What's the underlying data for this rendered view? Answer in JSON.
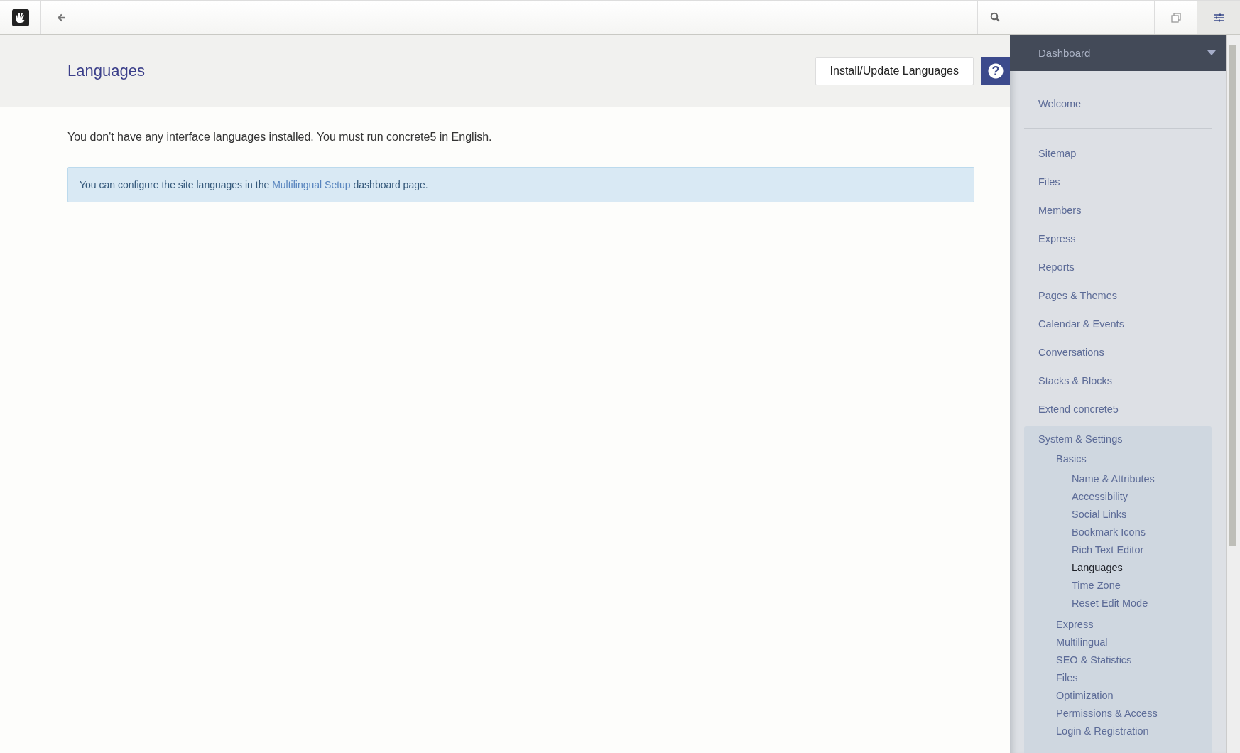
{
  "header": {
    "title": "Languages",
    "install_button": "Install/Update Languages",
    "help_button": "?"
  },
  "message": "You don't have any interface languages installed. You must run concrete5 in English.",
  "alert": {
    "before": "You can configure the site languages in the ",
    "link": "Multilingual Setup",
    "after": " dashboard page."
  },
  "sidebar": {
    "title": "Dashboard",
    "top_items": [
      {
        "label": "Welcome",
        "selected": false
      }
    ],
    "items": [
      {
        "label": "Sitemap",
        "selected": false
      },
      {
        "label": "Files",
        "selected": false
      },
      {
        "label": "Members",
        "selected": false
      },
      {
        "label": "Express",
        "selected": false
      },
      {
        "label": "Reports",
        "selected": false
      },
      {
        "label": "Pages & Themes",
        "selected": false
      },
      {
        "label": "Calendar & Events",
        "selected": false
      },
      {
        "label": "Conversations",
        "selected": false
      },
      {
        "label": "Stacks & Blocks",
        "selected": false
      },
      {
        "label": "Extend concrete5",
        "selected": false
      },
      {
        "label": "System & Settings",
        "selected": false,
        "children": [
          {
            "label": "Basics",
            "selected": false,
            "children": [
              {
                "label": "Name & Attributes",
                "selected": false
              },
              {
                "label": "Accessibility",
                "selected": false
              },
              {
                "label": "Social Links",
                "selected": false
              },
              {
                "label": "Bookmark Icons",
                "selected": false
              },
              {
                "label": "Rich Text Editor",
                "selected": false
              },
              {
                "label": "Languages",
                "selected": true
              },
              {
                "label": "Time Zone",
                "selected": false
              },
              {
                "label": "Reset Edit Mode",
                "selected": false
              }
            ]
          },
          {
            "label": "Express",
            "selected": false
          },
          {
            "label": "Multilingual",
            "selected": false
          },
          {
            "label": "SEO & Statistics",
            "selected": false
          },
          {
            "label": "Files",
            "selected": false
          },
          {
            "label": "Optimization",
            "selected": false
          },
          {
            "label": "Permissions & Access",
            "selected": false
          },
          {
            "label": "Login & Registration",
            "selected": false
          }
        ]
      }
    ]
  }
}
